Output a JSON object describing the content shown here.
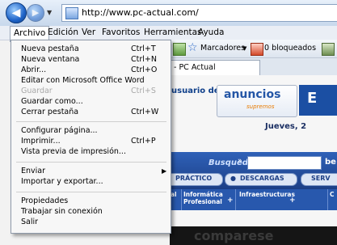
{
  "address_bar": {
    "url": "http://www.pc-actual.com/"
  },
  "menubar": {
    "items": [
      "Archivo",
      "Edición",
      "Ver",
      "Favoritos",
      "Herramientas",
      "Ayuda"
    ]
  },
  "toolbar": {
    "bookmarks_label": "Marcadores",
    "blocked_label": "0 bloqueados"
  },
  "tab": {
    "title": "- PC Actual"
  },
  "page": {
    "welcome_text": "usuario de",
    "ad_word": "anuncios",
    "ad_sub": "supremos",
    "corner_letter": "E",
    "date_text": "Jueves, 2",
    "search_label": "Busqueda",
    "search_go": "be",
    "pill1": "PRÁCTICO",
    "pill2": "DESCARGAS",
    "pill3": "SERV",
    "cat0": "al",
    "cat1": "Informática Profesional",
    "cat2": "Infraestructuras",
    "cat3": "C",
    "black_text": "comparese"
  },
  "archivo_menu": {
    "items": [
      {
        "label": "Nueva pestaña",
        "shortcut": "Ctrl+T",
        "disabled": false
      },
      {
        "label": "Nueva ventana",
        "shortcut": "Ctrl+N",
        "disabled": false
      },
      {
        "label": "Abrir...",
        "shortcut": "Ctrl+O",
        "disabled": false
      },
      {
        "label": "Editar con Microsoft Office Word",
        "shortcut": "",
        "disabled": false
      },
      {
        "label": "Guardar",
        "shortcut": "Ctrl+S",
        "disabled": true
      },
      {
        "label": "Guardar como...",
        "shortcut": "",
        "disabled": false
      },
      {
        "label": "Cerrar pestaña",
        "shortcut": "Ctrl+W",
        "disabled": false
      },
      {
        "label": "Configurar página...",
        "shortcut": "",
        "disabled": false
      },
      {
        "label": "Imprimir...",
        "shortcut": "Ctrl+P",
        "disabled": false
      },
      {
        "label": "Vista previa de impresión...",
        "shortcut": "",
        "disabled": false
      },
      {
        "label": "Enviar",
        "shortcut": "",
        "disabled": false
      },
      {
        "label": "Importar y exportar...",
        "shortcut": "",
        "disabled": false
      },
      {
        "label": "Propiedades",
        "shortcut": "",
        "disabled": false
      },
      {
        "label": "Trabajar sin conexión",
        "shortcut": "",
        "disabled": false
      },
      {
        "label": "Salir",
        "shortcut": "",
        "disabled": false
      }
    ]
  }
}
